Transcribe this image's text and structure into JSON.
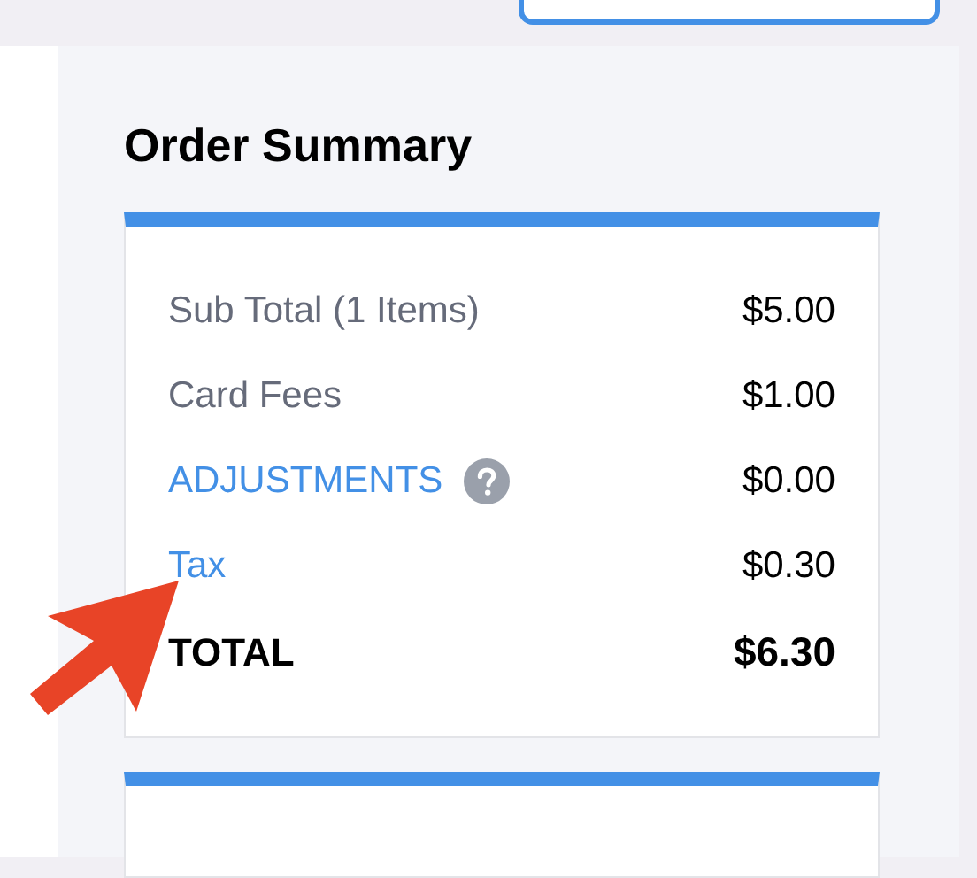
{
  "heading": "Order Summary",
  "summary_rows": [
    {
      "kind": "plain",
      "label": "Sub Total (1 Items)",
      "value": "$5.00"
    },
    {
      "kind": "plain",
      "label": "Card Fees",
      "value": "$1.00"
    },
    {
      "kind": "help-link",
      "label": "ADJUSTMENTS",
      "value": "$0.00"
    },
    {
      "kind": "link",
      "label": "Tax",
      "value": "$0.30"
    },
    {
      "kind": "total",
      "label": "TOTAL",
      "value": "$6.30"
    }
  ]
}
